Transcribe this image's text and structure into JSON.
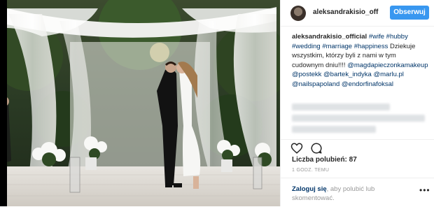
{
  "post": {
    "image_alt": "wedding ceremony photo"
  },
  "header": {
    "username": "aleksandrakisio_off",
    "follow_label": "Obserwuj"
  },
  "caption": {
    "author": "aleksandrakisio_official",
    "parts": [
      {
        "text": "#wife",
        "type": "tag"
      },
      {
        "text": " ",
        "type": "plain"
      },
      {
        "text": "#hubby",
        "type": "tag"
      },
      {
        "text": " ",
        "type": "plain"
      },
      {
        "text": "#wedding",
        "type": "tag"
      },
      {
        "text": " ",
        "type": "plain"
      },
      {
        "text": "#marriage",
        "type": "tag"
      },
      {
        "text": " ",
        "type": "plain"
      },
      {
        "text": "#happiness",
        "type": "tag"
      },
      {
        "text": " Dziekuje wszystkim, którzy byli z nami w tym cudownym dniu!!!! ",
        "type": "plain"
      },
      {
        "text": "@magdapieczonkamakeup",
        "type": "tag"
      },
      {
        "text": " ",
        "type": "plain"
      },
      {
        "text": "@postekk",
        "type": "tag"
      },
      {
        "text": " ",
        "type": "plain"
      },
      {
        "text": "@bartek_indyka",
        "type": "tag"
      },
      {
        "text": " ",
        "type": "plain"
      },
      {
        "text": "@marlu.pl",
        "type": "tag"
      },
      {
        "text": " ",
        "type": "plain"
      },
      {
        "text": "@nailspapoland",
        "type": "tag"
      },
      {
        "text": " ",
        "type": "plain"
      },
      {
        "text": "@endorfinafoksal",
        "type": "tag"
      }
    ]
  },
  "actions": {
    "like_icon": "heart-icon",
    "comment_icon": "comment-icon"
  },
  "likes": {
    "label": "Liczba polubień: 87"
  },
  "time": {
    "label": "1 GODZ. TEMU"
  },
  "login": {
    "link_label": "Zaloguj się",
    "rest_label": ", aby polubić lub skomentować."
  },
  "more": {
    "label": "•••",
    "icon": "more-options-icon"
  },
  "colors": {
    "accent": "#3897f0",
    "link": "#003569"
  }
}
